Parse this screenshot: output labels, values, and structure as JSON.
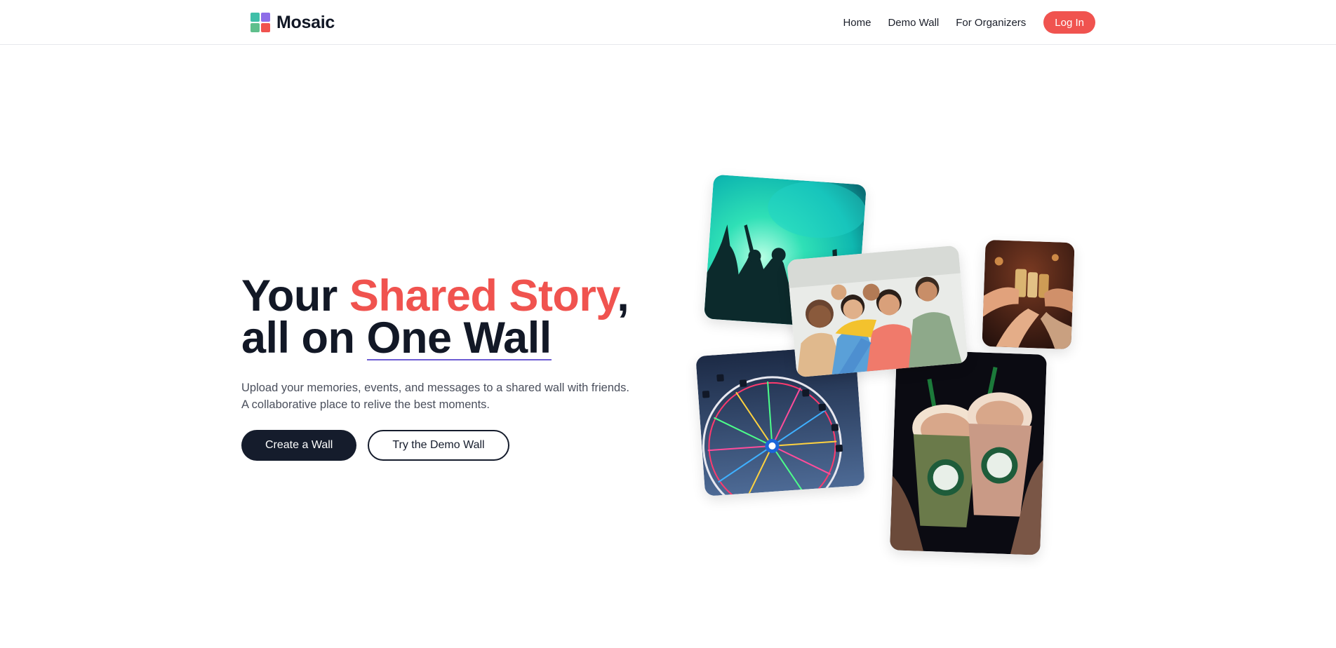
{
  "brand": {
    "name": "Mosaic",
    "logo_colors": [
      "#3fbfa8",
      "#8e6de8",
      "#5fbf8c",
      "#f0534f"
    ]
  },
  "nav": {
    "links": [
      "Home",
      "Demo Wall",
      "For Organizers"
    ],
    "login_label": "Log In"
  },
  "hero": {
    "title_word1": "Your",
    "title_accent": "Shared Story",
    "title_comma": ",",
    "title_line2_prefix": "all on",
    "title_underlined": "One Wall",
    "subtitle": "Upload your memories, events, and messages to a shared wall with friends. A collaborative place to relive the best moments.",
    "primary_cta": "Create a Wall",
    "secondary_cta": "Try the Demo Wall"
  },
  "photos": [
    {
      "name": "concert-photo",
      "subject": "crowd dancing at concert under green light"
    },
    {
      "name": "friends-selfie-photo",
      "subject": "group of friends taking a selfie"
    },
    {
      "name": "cheers-photo",
      "subject": "friends toasting drinks"
    },
    {
      "name": "ferris-wheel-photo",
      "subject": "illuminated ferris wheel at night"
    },
    {
      "name": "drinks-photo",
      "subject": "two frappuccino cups held up"
    }
  ],
  "colors": {
    "accent": "#f0534f",
    "dark": "#151c2c",
    "underline": "#6d5dd3",
    "text_muted": "#4a4f5c"
  }
}
